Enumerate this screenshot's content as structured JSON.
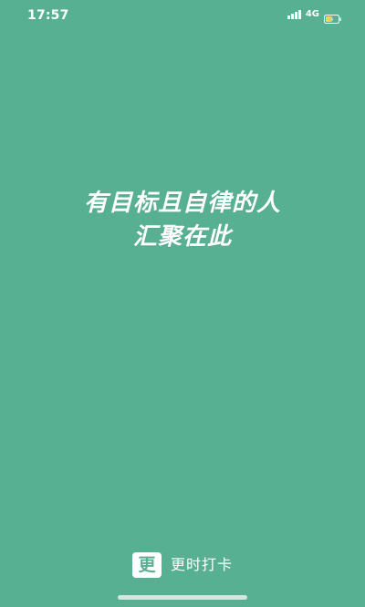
{
  "status_bar": {
    "time": "17:57",
    "network": "4G",
    "icons": [
      "signal-icon",
      "battery-charging-icon"
    ]
  },
  "slogan": {
    "line1": "有目标且自律的人",
    "line2": "汇聚在此"
  },
  "brand": {
    "logo_char": "更",
    "name": "更时打卡"
  },
  "colors": {
    "background": "#58b093",
    "text": "#ffffff",
    "battery_accent": "#f4d64a"
  }
}
